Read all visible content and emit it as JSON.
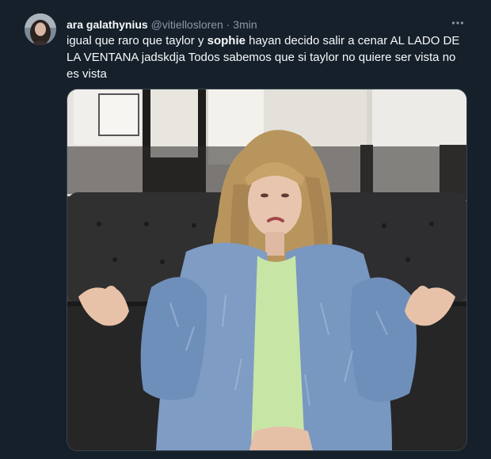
{
  "tweet": {
    "display_name": "ara galathynius",
    "handle": "@vitiellosloren",
    "separator": "·",
    "time": "3min",
    "text_part1": "igual que raro que taylor y ",
    "text_bold": "sophie",
    "text_part2": " hayan decido salir a cenar AL LADO DE LA VENTANA jadskdja Todos sabemos que si taylor no quiere ser vista no es vista",
    "more_icon": "more-horizontal-icon"
  },
  "colors": {
    "background": "#15202b",
    "text": "#f7f9f9",
    "secondary": "#8b98a5",
    "border": "#38444d"
  }
}
